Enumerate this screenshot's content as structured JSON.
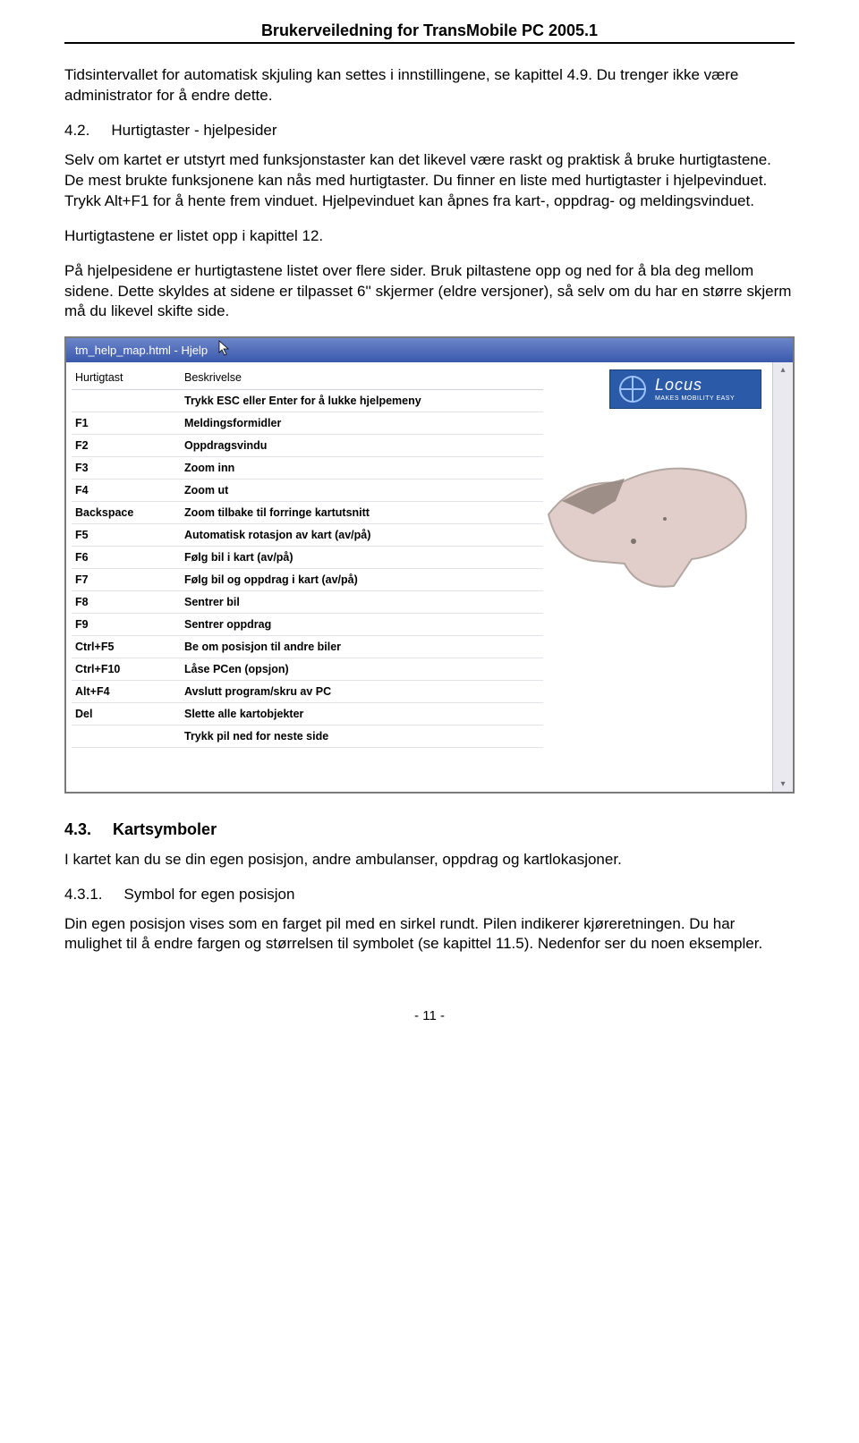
{
  "doc_title": "Brukerveiledning for TransMobile PC 2005.1",
  "intro_p1": "Tidsintervallet for automatisk skjuling kan settes i innstillingene, se kapittel 4.9. Du trenger ikke være administrator for å endre dette.",
  "sec_4_2_num": "4.2.",
  "sec_4_2_title": "Hurtigtaster - hjelpesider",
  "p2": "Selv om kartet er utstyrt med funksjonstaster kan det likevel være raskt og praktisk å bruke hurtigtastene. De mest brukte funksjonene kan nås med hurtigtaster. Du finner en liste med hurtigtaster i hjelpevinduet. Trykk Alt+F1 for å hente frem vinduet. Hjelpevinduet kan åpnes fra kart-, oppdrag- og meldingsvinduet.",
  "p3": "Hurtigtastene er listet opp i kapittel 12.",
  "p4": "På hjelpesidene er hurtigtastene listet over flere sider. Bruk piltastene opp og ned for å bla deg mellom sidene. Dette skyldes at sidene er tilpasset 6'' skjermer (eldre versjoner), så selv om du har en større skjerm må du likevel skifte side.",
  "window": {
    "title": "tm_help_map.html - Hjelp",
    "col_key": "Hurtigtast",
    "col_desc": "Beskrivelse",
    "rows": [
      {
        "k": "",
        "d": "Trykk ESC eller Enter for å lukke hjelpemeny"
      },
      {
        "k": "F1",
        "d": "Meldingsformidler"
      },
      {
        "k": "F2",
        "d": "Oppdragsvindu"
      },
      {
        "k": "F3",
        "d": "Zoom inn"
      },
      {
        "k": "F4",
        "d": "Zoom ut"
      },
      {
        "k": "Backspace",
        "d": "Zoom tilbake til forringe kartutsnitt"
      },
      {
        "k": "F5",
        "d": "Automatisk rotasjon av kart (av/på)"
      },
      {
        "k": "F6",
        "d": "Følg bil i kart (av/på)"
      },
      {
        "k": "F7",
        "d": "Følg bil og oppdrag i kart (av/på)"
      },
      {
        "k": "F8",
        "d": "Sentrer bil"
      },
      {
        "k": "F9",
        "d": "Sentrer oppdrag"
      },
      {
        "k": "Ctrl+F5",
        "d": "Be om posisjon til andre biler"
      },
      {
        "k": "Ctrl+F10",
        "d": "Låse PCen (opsjon)"
      },
      {
        "k": "Alt+F4",
        "d": "Avslutt program/skru av PC"
      },
      {
        "k": "Del",
        "d": "Slette alle kartobjekter"
      },
      {
        "k": "",
        "d": "Trykk pil ned for neste side"
      }
    ],
    "logo_brand": "Locus",
    "logo_tag": "MAKES MOBILITY EASY"
  },
  "sec_4_3_num": "4.3.",
  "sec_4_3_title": "Kartsymboler",
  "p5": "I kartet kan du se din egen posisjon, andre ambulanser, oppdrag og kartlokasjoner.",
  "sec_4_3_1_num": "4.3.1.",
  "sec_4_3_1_title": "Symbol for egen posisjon",
  "p6": "Din egen posisjon vises som en farget pil med en sirkel rundt. Pilen indikerer kjøreretningen. Du har mulighet til å endre fargen og størrelsen til symbolet (se kapittel 11.5). Nedenfor ser du noen eksempler.",
  "page_num": "- 11 -"
}
